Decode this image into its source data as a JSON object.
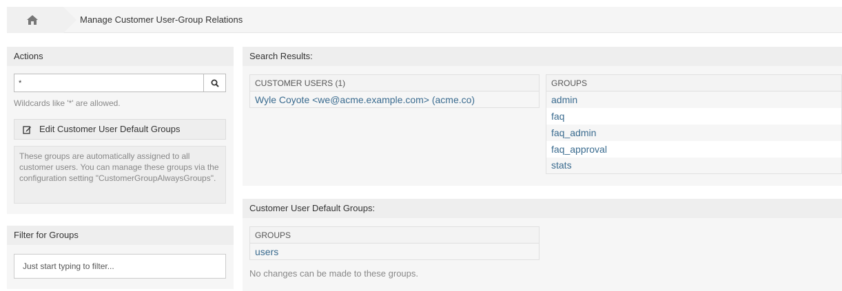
{
  "breadcrumb": {
    "home_icon": "home-icon",
    "title": "Manage Customer User-Group Relations"
  },
  "actions": {
    "header": "Actions",
    "search": {
      "value": "*",
      "button_icon": "search-icon"
    },
    "hint": "Wildcards like '*' are allowed.",
    "edit_button": {
      "label": "Edit Customer User Default Groups",
      "icon": "edit-icon"
    },
    "info": "These groups are automatically assigned to all customer users. You can manage these groups via the configuration setting \"CustomerGroupAlwaysGroups\"."
  },
  "filter": {
    "header": "Filter for Groups",
    "placeholder": "Just start typing to filter..."
  },
  "search_results": {
    "header": "Search Results:",
    "customer_users": {
      "column": "CUSTOMER USERS (1)",
      "rows": [
        "Wyle Coyote <we@acme.example.com> (acme.co)"
      ]
    },
    "groups": {
      "column": "GROUPS",
      "rows": [
        "admin",
        "faq",
        "faq_admin",
        "faq_approval",
        "stats"
      ]
    }
  },
  "default_groups": {
    "header": "Customer User Default Groups:",
    "column": "GROUPS",
    "rows": [
      "users"
    ],
    "note": "No changes can be made to these groups."
  }
}
